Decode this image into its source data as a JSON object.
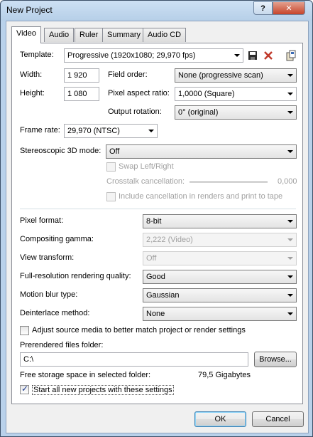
{
  "window": {
    "title": "New Project",
    "help_glyph": "?",
    "close_glyph": "✕"
  },
  "tabs": [
    {
      "label": "Video"
    },
    {
      "label": "Audio"
    },
    {
      "label": "Ruler"
    },
    {
      "label": "Summary"
    },
    {
      "label": "Audio CD"
    }
  ],
  "video": {
    "template_label": "Template:",
    "template_value": "Progressive (1920x1080; 29,970 fps)",
    "width_label": "Width:",
    "width_value": "1 920",
    "height_label": "Height:",
    "height_value": "1 080",
    "field_order_label": "Field order:",
    "field_order_value": "None (progressive scan)",
    "pixel_aspect_label": "Pixel aspect ratio:",
    "pixel_aspect_value": "1,0000 (Square)",
    "output_rotation_label": "Output rotation:",
    "output_rotation_value": "0° (original)",
    "frame_rate_label": "Frame rate:",
    "frame_rate_value": "29,970 (NTSC)",
    "stereo_label": "Stereoscopic 3D mode:",
    "stereo_value": "Off",
    "swap_label": "Swap Left/Right",
    "crosstalk_label": "Crosstalk cancellation:",
    "crosstalk_value": "0,000",
    "include_cancel_label": "Include cancellation in renders and print to tape",
    "pixel_format_label": "Pixel format:",
    "pixel_format_value": "8-bit",
    "gamma_label": "Compositing gamma:",
    "gamma_value": "2,222 (Video)",
    "view_transform_label": "View transform:",
    "view_transform_value": "Off",
    "render_quality_label": "Full-resolution rendering quality:",
    "render_quality_value": "Good",
    "motion_blur_label": "Motion blur type:",
    "motion_blur_value": "Gaussian",
    "deinterlace_label": "Deinterlace method:",
    "deinterlace_value": "None",
    "adjust_source_label": "Adjust source media to better match project or render settings",
    "adjust_source_checked": false,
    "prerendered_label": "Prerendered files folder:",
    "prerendered_value": "C:\\",
    "browse_label": "Browse...",
    "free_storage_label": "Free storage space in selected folder:",
    "free_storage_value": "79,5 Gigabytes",
    "start_all_label": "Start all new projects with these settings",
    "start_all_checked": true
  },
  "footer": {
    "ok_label": "OK",
    "cancel_label": "Cancel"
  }
}
